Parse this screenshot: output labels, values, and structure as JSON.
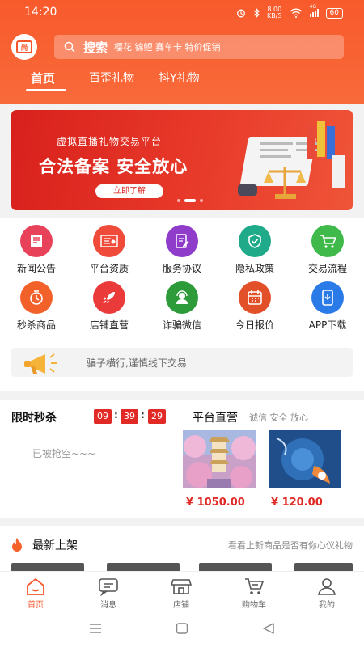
{
  "status_bar": {
    "time": "14:20",
    "net_speed_value": "8.00",
    "net_speed_unit": "KB/S",
    "signal": "4G",
    "battery": "60"
  },
  "header": {
    "logo_text": "尚",
    "search": {
      "keyword": "搜索",
      "placeholder": "樱花 锦鲤 赛车卡 特价促销"
    },
    "tabs": [
      {
        "label": "首页",
        "active": true
      },
      {
        "label": "百歪礼物",
        "active": false
      },
      {
        "label": "抖Y礼物",
        "active": false
      }
    ]
  },
  "banner": {
    "subtitle": "虚拟直播礼物交易平台",
    "headline": "合法备案 安全放心",
    "button": "立即了解",
    "slide_count": 3,
    "active_slide": 2,
    "colors": {
      "bg": "#d8201c"
    }
  },
  "icon_grid": [
    {
      "label": "新闻公告",
      "icon": "news-icon",
      "color": "#e8415a"
    },
    {
      "label": "平台资质",
      "icon": "certificate-icon",
      "color": "#ef4a3a"
    },
    {
      "label": "服务协议",
      "icon": "agreement-icon",
      "color": "#8e3cc9"
    },
    {
      "label": "隐私政策",
      "icon": "shield-icon",
      "color": "#1faa8a"
    },
    {
      "label": "交易流程",
      "icon": "cart-icon",
      "color": "#3fb94a"
    },
    {
      "label": "秒杀商品",
      "icon": "timer-icon",
      "color": "#f2612a"
    },
    {
      "label": "店铺直营",
      "icon": "rocket-icon",
      "color": "#ea3a3a"
    },
    {
      "label": "诈骗微信",
      "icon": "support-icon",
      "color": "#2e9b3a"
    },
    {
      "label": "今日报价",
      "icon": "calendar-icon",
      "color": "#e2502a"
    },
    {
      "label": "APP下载",
      "icon": "phone-download-icon",
      "color": "#2a7be8"
    }
  ],
  "notice": {
    "icon": "megaphone-icon",
    "text": "骗子横行,谨慎线下交易"
  },
  "flash_sale": {
    "title": "限时秒杀",
    "countdown": [
      "09",
      "39",
      "29"
    ],
    "empty_text": "已被抢空~~~"
  },
  "platform_direct": {
    "title": "平台直营",
    "tagline": "诚信 安全 放心",
    "products": [
      {
        "price": "¥ 1050.00",
        "image": "sakura-pavilion-image"
      },
      {
        "price": "¥ 120.00",
        "image": "koi-fish-image"
      }
    ]
  },
  "newest": {
    "title": "最新上架",
    "subtitle": "看看上新商品是否有你心仪礼物",
    "icon": "fire-icon"
  },
  "tab_bar": [
    {
      "label": "首页",
      "icon": "home-icon",
      "active": true
    },
    {
      "label": "消息",
      "icon": "message-icon",
      "active": false
    },
    {
      "label": "店铺",
      "icon": "store-icon",
      "active": false
    },
    {
      "label": "购物车",
      "icon": "shopping-cart-icon",
      "active": false
    },
    {
      "label": "我的",
      "icon": "user-icon",
      "active": false
    }
  ],
  "colors": {
    "accent": "#f8562a",
    "price": "#e12a26"
  }
}
